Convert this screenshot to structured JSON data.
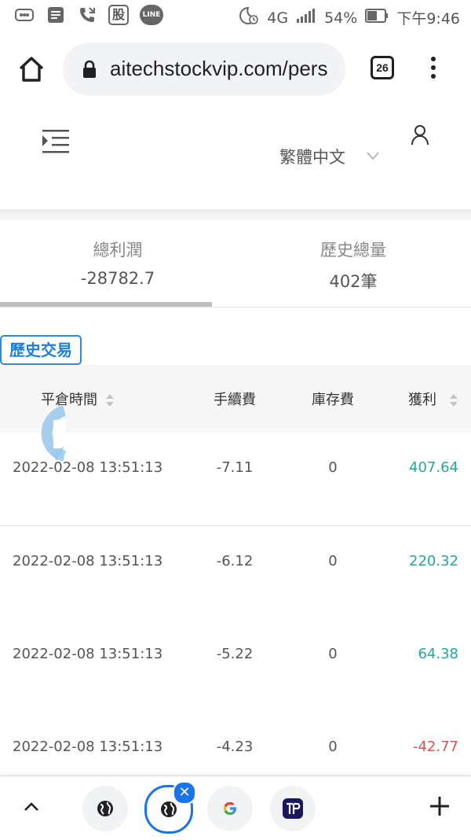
{
  "status_bar": {
    "gu_label": "股",
    "line_label": "LINE",
    "network": "4G",
    "battery": "54%",
    "time": "下午9:46"
  },
  "browser": {
    "url": "aitechstockvip.com/pers",
    "tab_count": "26"
  },
  "header": {
    "language": "繁體中文"
  },
  "summary": {
    "total_profit_label": "總利潤",
    "total_profit_value": "-28782.7",
    "history_total_label": "歷史總量",
    "history_total_value": "402筆"
  },
  "section": {
    "title": "歷史交易"
  },
  "table": {
    "columns": [
      "平倉時間",
      "手續費",
      "庫存費",
      "獲利"
    ],
    "rows": [
      {
        "time": "2022-02-08 13:51:13",
        "fee": "-7.11",
        "storage": "0",
        "profit": "407.64",
        "sign": "pos"
      },
      {
        "time": "2022-02-08 13:51:13",
        "fee": "-6.12",
        "storage": "0",
        "profit": "220.32",
        "sign": "pos"
      },
      {
        "time": "2022-02-08 13:51:13",
        "fee": "-5.22",
        "storage": "0",
        "profit": "64.38",
        "sign": "pos"
      },
      {
        "time": "2022-02-08 13:51:13",
        "fee": "-4.23",
        "storage": "0",
        "profit": "-42.77",
        "sign": "neg"
      }
    ]
  },
  "colors": {
    "accent": "#1a73e8",
    "badge": "#2a8be0",
    "positive": "#26a69a",
    "negative": "#d9534f"
  },
  "bottom_bar": {
    "tabs": [
      "globe-icon",
      "globe-icon",
      "google-icon",
      "tp-app-icon"
    ]
  }
}
